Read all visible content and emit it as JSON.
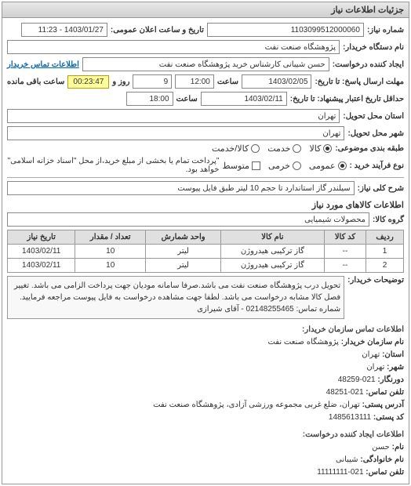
{
  "panel_title": "جزئیات اطلاعات نیاز",
  "request_number": {
    "label": "شماره نیاز:",
    "value": "1103099512000060"
  },
  "announce": {
    "label": "تاریخ و ساعت اعلان عمومی:",
    "value": "1403/01/27 - 11:23"
  },
  "buyer_org": {
    "label": "نام دستگاه خریدار:",
    "value": "پژوهشگاه صنعت نفت"
  },
  "requester": {
    "label": "ایجاد کننده درخواست:",
    "value": "حسن شیبانی کارشناس خرید پژوهشگاه صنعت نفت"
  },
  "buyer_contact_link": "اطلاعات تماس خریدار",
  "deadline_reply": {
    "label": "مهلت ارسال پاسخ: تا تاریخ:",
    "date": "1403/02/05",
    "time_label": "ساعت",
    "time": "12:00",
    "days": "9",
    "days_label": "روز و",
    "remaining": "00:23:47",
    "remaining_label": "ساعت باقی مانده"
  },
  "deadline_deliver": {
    "label": "حداقل تاریخ اعتبار پیشنهاد: تا تاریخ:",
    "date": "1403/02/11",
    "time_label": "ساعت",
    "time": "18:00"
  },
  "province": {
    "label": "استان محل تحویل:",
    "value": "تهران"
  },
  "city": {
    "label": "شهر محل تحویل:",
    "value": "تهران"
  },
  "category": {
    "label": "طبقه بندی موضوعی:",
    "options": [
      {
        "label": "کالا",
        "name": "radio-goods",
        "checked": true
      },
      {
        "label": "خدمت",
        "name": "radio-service",
        "checked": false
      },
      {
        "label": "کالا/خدمت",
        "name": "radio-both",
        "checked": false
      }
    ]
  },
  "purchase_type": {
    "label": "نوع فرآیند خرید :",
    "options": [
      {
        "label": "عمومی",
        "name": "radio-public",
        "checked": true
      },
      {
        "label": "خرمی",
        "name": "radio-private",
        "checked": false
      },
      {
        "label": "متوسط",
        "name": "radio-medium",
        "checked": false
      }
    ],
    "note": "\"پرداخت تمام یا بخشی از مبلغ خرید،از محل \"اسناد خزانه اسلامی\" خواهد بود."
  },
  "overall_desc": {
    "label": "شرح کلی نیاز:",
    "value": "سیلندر گاز استاندارد تا حجم 10 لیتر طبق فایل پیوست"
  },
  "goods_info_title": "اطلاعات کالاهای مورد نیاز",
  "group": {
    "label": "گروه کالا:",
    "value": "محصولات شیمیایی"
  },
  "table": {
    "headers": [
      "ردیف",
      "کد کالا",
      "نام کالا",
      "واحد شمارش",
      "تعداد / مقدار",
      "تاریخ نیاز"
    ],
    "rows": [
      {
        "idx": "1",
        "code": "--",
        "name": "گاز ترکیبی هیدروژن",
        "unit": "لیتر",
        "qty": "10",
        "date": "1403/02/11"
      },
      {
        "idx": "2",
        "code": "--",
        "name": "گاز ترکیبی هیدروژن",
        "unit": "لیتر",
        "qty": "10",
        "date": "1403/02/11"
      }
    ]
  },
  "buyer_desc": {
    "label": "توضیحات خریدار:",
    "value": "تحویل درب پژوهشگاه صنعت نفت می باشد.صرفا سامانه مودیان جهت پرداخت الزامی می باشد. تغییر فصل کالا مشابه درخواست می باشد. لطفا جهت مشاهده درخواست به فایل پیوست مراجعه فرمایید. شماره تماس: 02148255465 - آقای شیرازی"
  },
  "contact_org": {
    "title": "اطلاعات تماس سازمان خریدار:",
    "lines": {
      "org": {
        "label": "نام سازمان خریدار:",
        "value": "پژوهشگاه صنعت نفت"
      },
      "prov": {
        "label": "استان:",
        "value": "تهران"
      },
      "city": {
        "label": "شهر:",
        "value": "تهران"
      },
      "postal": {
        "label": "دورنگار:",
        "value": "021-48259"
      },
      "phone": {
        "label": "تلفن تماس:",
        "value": "021-48251"
      },
      "address": {
        "label": "آدرس پستی:",
        "value": "تهران، ضلع غربی مجموعه ورزشی آزادی، پژوهشگاه صنعت نفت"
      },
      "postcode": {
        "label": "کد پستی:",
        "value": "1485613111"
      }
    }
  },
  "contact_creator": {
    "title": "اطلاعات ایجاد کننده درخواست:",
    "lines": {
      "name": {
        "label": "نام:",
        "value": "حسن"
      },
      "family": {
        "label": "نام خانوادگی:",
        "value": "شیبانی"
      },
      "phone": {
        "label": "تلفن تماس:",
        "value": "021-11111111"
      }
    }
  }
}
